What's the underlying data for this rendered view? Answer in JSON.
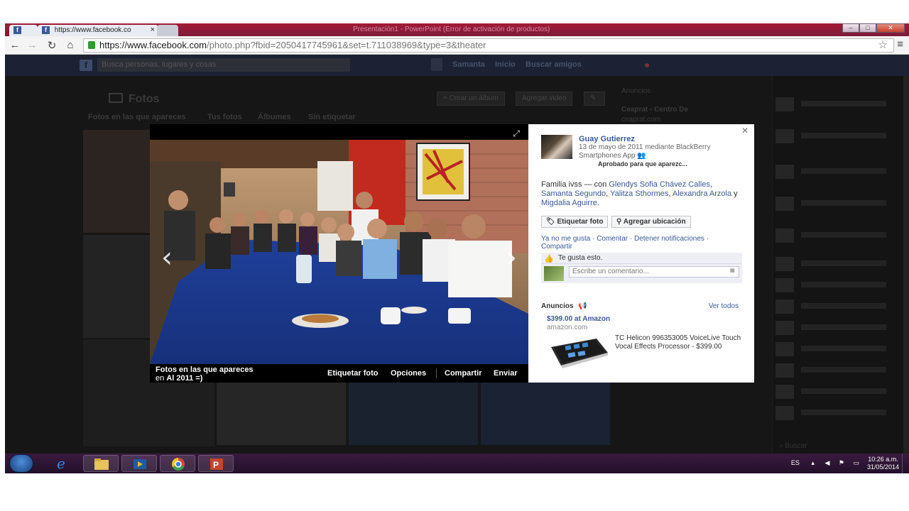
{
  "browser": {
    "tabs": [
      {
        "label": ""
      },
      {
        "label": "https://www.facebook.co"
      }
    ],
    "faded_window_title": "Presentación1 - PowerPoint (Error de activación de productos)",
    "url_host": "https://www.facebook.com",
    "url_path": "/photo.php?fbid=2050417745961&set=t.711038969&type=3&theater"
  },
  "fb_header": {
    "search_placeholder": "Busca personas, lugares y cosas",
    "user": "Samanta",
    "home": "Inicio",
    "find_friends": "Buscar amigos"
  },
  "dimmed_page": {
    "title": "Fotos",
    "subtabs": [
      "Fotos en las que apareces",
      "Tus fotos",
      "Álbumes",
      "Sin etiquetar"
    ],
    "create_album": "+ Crear un álbum",
    "add_video": "Agregar video",
    "ads_heading": "Anuncios",
    "ad_dim_1": "Ceaprat - Centro De",
    "ad_dim_2": "ceaprat.com",
    "chat_search": "Buscar"
  },
  "photo": {
    "album_line1": "Fotos en las que apareces",
    "album_line2_prefix": "en",
    "album_name": "Al 2011 =)",
    "actions": [
      "Etiquetar foto",
      "Opciones",
      "Compartir",
      "Enviar"
    ]
  },
  "side": {
    "author": "Guay Gutierrez",
    "meta": "13 de mayo de 2011 mediante BlackBerry Smartphones App",
    "approved": "Aprobado para que aparezc...",
    "caption_prefix": "Familia ivss — con ",
    "tagged": [
      "Glendys Sofia Chávez Calles",
      "Samanta Segundo",
      "Yalitza Sthormes",
      "Alexandra Arzola",
      "Migdalia Aguirre"
    ],
    "sep_comma": ", ",
    "sep_and": " y ",
    "period": ".",
    "tag_button": "Etiquetar foto",
    "location_button": "Agregar ubicación",
    "actions_line": "Ya no me gusta · Comentar · Detener notificaciones · Compartir",
    "likes": "Te gusta esto.",
    "comment_placeholder": "Escribe un comentario...",
    "ads_label": "Anuncios",
    "see_all": "Ver todos",
    "ad_title": "$399.00 at Amazon",
    "ad_domain": "amazon.com",
    "ad_desc": "TC Helicon 996353005 VoiceLive Touch Vocal Effects Processor - $399.00"
  },
  "taskbar": {
    "lang": "ES",
    "time": "10:26 a.m.",
    "date": "31/05/2014"
  },
  "icons": {
    "close": "close-icon",
    "expand": "expand-icon",
    "like": "thumbs-up-icon",
    "camera": "camera-icon"
  },
  "colors": {
    "facebook_blue": "#3b5998",
    "theater_bg": "#000000"
  }
}
